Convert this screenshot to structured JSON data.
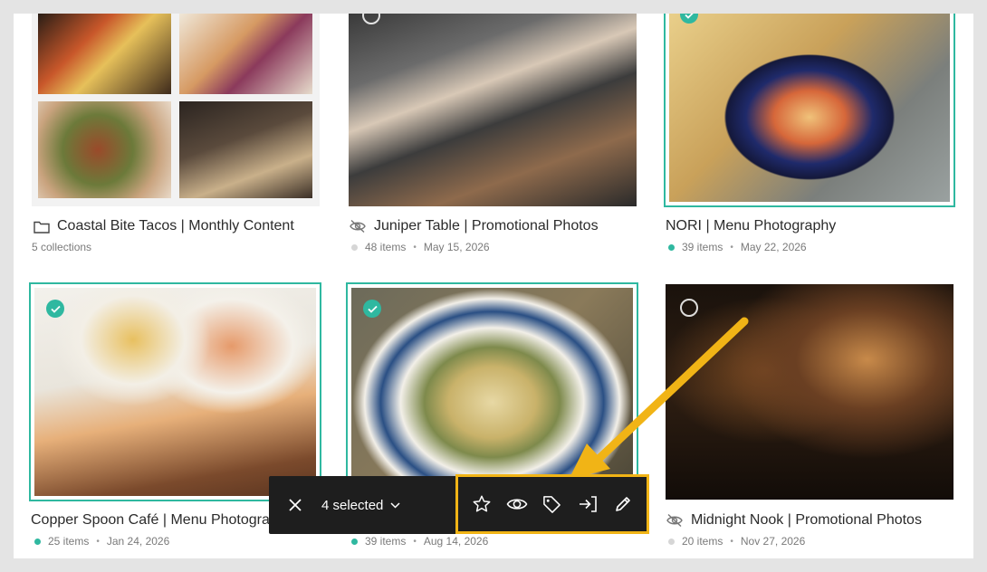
{
  "collections": [
    {
      "title": "Coastal Bite Tacos | Monthly Content",
      "title_icon": "folder-icon",
      "meta": "5 collections"
    },
    {
      "title": "Juniper Table | Promotional Photos",
      "title_icon": "eye-off-icon",
      "items": "48 items",
      "date": "May 15, 2026",
      "status_color": "#d6d6d6"
    },
    {
      "title": "NORI | Menu Photography",
      "items": "39 items",
      "date": "May 22, 2026",
      "status_color": "#2fb8a0",
      "selected": true
    },
    {
      "title": "Copper Spoon Café | Menu Photography",
      "items": "25 items",
      "date": "Jan 24, 2026",
      "status_color": "#2fb8a0",
      "selected": true
    },
    {
      "title": "",
      "items": "39 items",
      "date": "Aug 14, 2026",
      "status_color": "#2fb8a0",
      "selected": true
    },
    {
      "title": "Midnight Nook | Promotional Photos",
      "title_icon": "eye-off-icon",
      "items": "20 items",
      "date": "Nov 27, 2026",
      "status_color": "#d6d6d6"
    }
  ],
  "selection_bar": {
    "count_label": "4 selected",
    "actions": [
      "star-icon",
      "eye-icon",
      "tag-icon",
      "move-to-icon",
      "pencil-icon"
    ]
  },
  "separator": "•",
  "colors": {
    "accent": "#2fb8a0",
    "highlight": "#f1b416",
    "bar_bg": "#1e1e1e"
  }
}
